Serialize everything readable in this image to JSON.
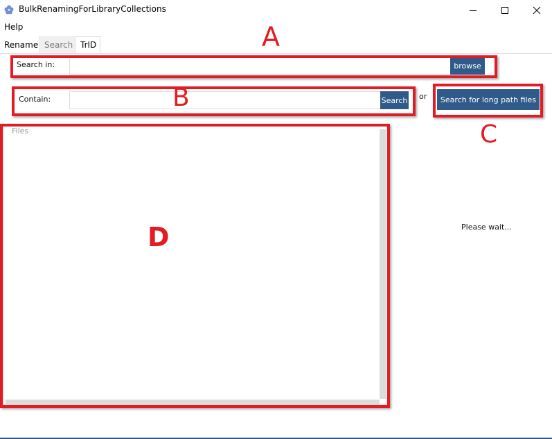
{
  "window": {
    "title": "BulkRenamingForLibraryCollections",
    "icon": "flower-icon",
    "controls": [
      "minimize-icon",
      "maximize-icon",
      "close-icon"
    ]
  },
  "menu": {
    "help": "Help"
  },
  "tabs": [
    {
      "label": "Rename",
      "active": false
    },
    {
      "label": "Search",
      "active": true
    },
    {
      "label": "TrID",
      "active": false
    }
  ],
  "search_in": {
    "label": "Search in:",
    "value": "",
    "button": "browse"
  },
  "contain": {
    "label": "Contain:",
    "value": "",
    "button": "Search"
  },
  "or_text": "or",
  "long_path_button": "Search for long path files",
  "files": {
    "label": "Files",
    "items": []
  },
  "status": "Please wait...",
  "annotations": {
    "a": "A",
    "b": "B",
    "c": "C",
    "d": "D"
  },
  "colors": {
    "accent": "#2f5a8a",
    "annotation": "#e31b23"
  }
}
